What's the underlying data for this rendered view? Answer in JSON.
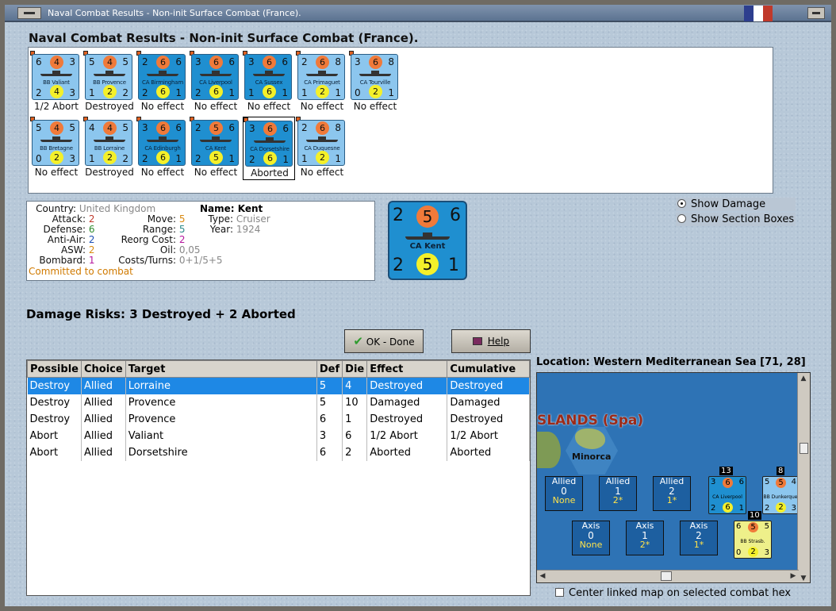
{
  "window_title": "Naval Combat Results - Non-init Surface Combat (France).",
  "header": "Naval Combat Results - Non-init Surface Combat (France).",
  "units": [
    {
      "name": "BB Valiant",
      "type": "bb",
      "tl": "6",
      "top": "4",
      "tr": "3",
      "bl": "2",
      "bot": "4",
      "br": "3",
      "result": "1/2 Abort"
    },
    {
      "name": "BB Provence",
      "type": "bb",
      "tl": "5",
      "top": "4",
      "tr": "5",
      "bl": "1",
      "bot": "2",
      "br": "2",
      "result": "Destroyed"
    },
    {
      "name": "CA Birmingham",
      "type": "ca",
      "tl": "2",
      "top": "6",
      "tr": "6",
      "bl": "2",
      "bot": "6",
      "br": "1",
      "result": "No effect"
    },
    {
      "name": "CA Liverpool",
      "type": "ca",
      "tl": "3",
      "top": "6",
      "tr": "6",
      "bl": "2",
      "bot": "6",
      "br": "1",
      "result": "No effect"
    },
    {
      "name": "CA Sussex",
      "type": "ca",
      "tl": "3",
      "top": "6",
      "tr": "6",
      "bl": "1",
      "bot": "6",
      "br": "1",
      "result": "No effect"
    },
    {
      "name": "CA Primaguet",
      "type": "bb",
      "tl": "2",
      "top": "6",
      "tr": "8",
      "bl": "1",
      "bot": "2",
      "br": "1",
      "result": "No effect"
    },
    {
      "name": "CA Tourville",
      "type": "bb",
      "tl": "3",
      "top": "6",
      "tr": "8",
      "bl": "0",
      "bot": "2",
      "br": "1",
      "result": "No effect"
    },
    {
      "name": "BB Bretagne",
      "type": "bb",
      "tl": "5",
      "top": "4",
      "tr": "5",
      "bl": "0",
      "bot": "2",
      "br": "3",
      "result": "No effect"
    },
    {
      "name": "BB Lorraine",
      "type": "bb",
      "tl": "4",
      "top": "4",
      "tr": "5",
      "bl": "1",
      "bot": "2",
      "br": "2",
      "result": "Destroyed"
    },
    {
      "name": "CA Edinburgh",
      "type": "ca",
      "tl": "3",
      "top": "6",
      "tr": "6",
      "bl": "2",
      "bot": "6",
      "br": "1",
      "result": "No effect"
    },
    {
      "name": "CA Kent",
      "type": "ca",
      "tl": "2",
      "top": "5",
      "tr": "6",
      "bl": "2",
      "bot": "5",
      "br": "1",
      "result": "No effect"
    },
    {
      "name": "CA Dorsetshire",
      "type": "ca",
      "tl": "3",
      "top": "6",
      "tr": "6",
      "bl": "2",
      "bot": "6",
      "br": "1",
      "result": "Aborted"
    },
    {
      "name": "CA Duquesne",
      "type": "bb",
      "tl": "2",
      "top": "6",
      "tr": "8",
      "bl": "1",
      "bot": "2",
      "br": "1",
      "result": "No effect"
    }
  ],
  "info": {
    "country_label": "Country:",
    "country": "United Kingdom",
    "attack_label": "Attack:",
    "attack": "2",
    "defense_label": "Defense:",
    "defense": "6",
    "antiair_label": "Anti-Air:",
    "antiair": "2",
    "asw_label": "ASW:",
    "asw": "2",
    "bombard_label": "Bombard:",
    "bombard": "1",
    "committed": "Committed to combat",
    "name_label": "Name:",
    "name": "Kent",
    "type_label": "Type:",
    "type": "Cruiser",
    "year_label": "Year:",
    "year": "1924",
    "move_label": "Move:",
    "move": "5",
    "range_label": "Range:",
    "range": "5",
    "reorg_label": "Reorg Cost:",
    "reorg": "2",
    "oil_label": "Oil:",
    "oil": "0,05",
    "costs_label": "Costs/Turns:",
    "costs": "0+1/5+5"
  },
  "bigchip": {
    "tl": "2",
    "top": "5",
    "tr": "6",
    "name": "CA Kent",
    "bl": "2",
    "bot": "5",
    "br": "1"
  },
  "options": {
    "show_damage": "Show Damage",
    "show_sections": "Show Section Boxes"
  },
  "risks": "Damage Risks: 3 Destroyed + 2 Aborted",
  "buttons": {
    "ok": "OK - Done",
    "help": "Help"
  },
  "table": {
    "headers": [
      "Possible",
      "Choice",
      "Target",
      "Def",
      "Die",
      "Effect",
      "Cumulative"
    ],
    "rows": [
      [
        "Destroy",
        "Allied",
        "Lorraine",
        "5",
        "4",
        "Destroyed",
        "Destroyed"
      ],
      [
        "Destroy",
        "Allied",
        "Provence",
        "5",
        "10",
        "Damaged",
        "Damaged"
      ],
      [
        "Destroy",
        "Allied",
        "Provence",
        "6",
        "1",
        "Destroyed",
        "Destroyed"
      ],
      [
        "Abort",
        "Allied",
        "Valiant",
        "3",
        "6",
        "1/2 Abort",
        "1/2 Abort"
      ],
      [
        "Abort",
        "Allied",
        "Dorsetshire",
        "6",
        "2",
        "Aborted",
        "Aborted"
      ]
    ]
  },
  "location": "Location:  Western Mediterranean Sea [71, 28]",
  "map": {
    "islands": "SLANDS (Spa)",
    "minorca": "Minorca",
    "allied": [
      {
        "t": "Allied",
        "n": "0",
        "s": "None"
      },
      {
        "t": "Allied",
        "n": "1",
        "s": "2*"
      },
      {
        "t": "Allied",
        "n": "2",
        "s": "1*"
      }
    ],
    "axis": [
      {
        "t": "Axis",
        "n": "0",
        "s": "None"
      },
      {
        "t": "Axis",
        "n": "1",
        "s": "2*"
      },
      {
        "t": "Axis",
        "n": "2",
        "s": "1*"
      }
    ],
    "counts": {
      "liverpool": "13",
      "dunkerque": "8",
      "strasbourg": "10"
    },
    "liverpool": {
      "name": "CA Liverpool",
      "tl": "3",
      "top": "6",
      "tr": "6",
      "bl": "2",
      "bot": "6",
      "br": "1"
    },
    "dunkerque": {
      "name": "BB Dunkerque",
      "tl": "5",
      "top": "5",
      "tr": "4",
      "bl": "2",
      "bot": "2",
      "br": "3"
    },
    "strasbourg": {
      "name": "BB Strasb.",
      "tl": "6",
      "top": "5",
      "tr": "5",
      "bl": "0",
      "bot": "2",
      "br": "3"
    }
  },
  "center_label": "Center linked map on selected combat hex",
  "colors": {
    "attack": "#c0392b",
    "defense": "#2e8b2e",
    "antiair": "#1e50b4",
    "asw": "#d98a10",
    "bombard": "#b5179e",
    "committed": "#d07a00",
    "flag_blue": "#2d3e8e",
    "flag_white": "#ffffff",
    "flag_red": "#c0392b"
  }
}
